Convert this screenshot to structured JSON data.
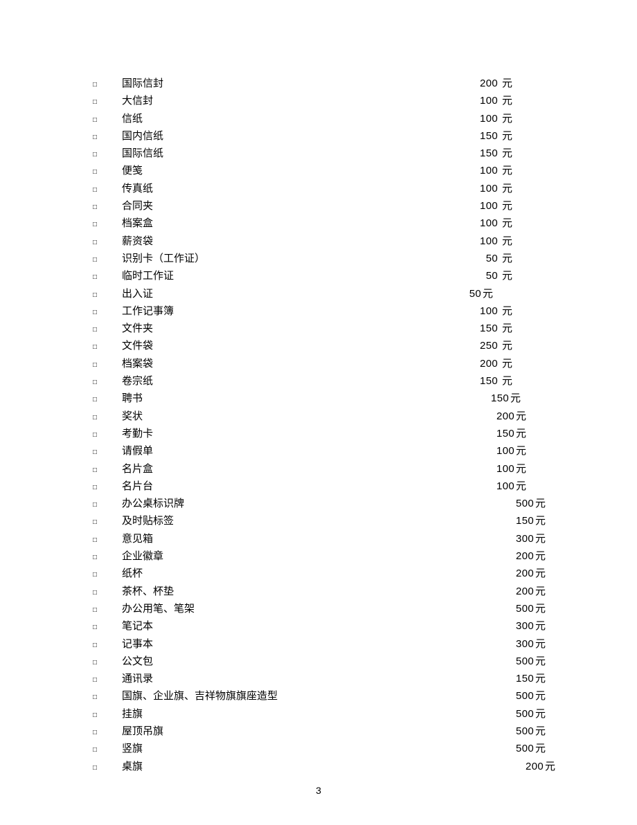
{
  "page_number": "3",
  "unit_label": "元",
  "bullet": "□",
  "items": [
    {
      "name": "国际信封",
      "price": "200",
      "indent": 0,
      "gap": 6
    },
    {
      "name": "大信封",
      "price": "100",
      "indent": 0,
      "gap": 6
    },
    {
      "name": "信纸",
      "price": "100",
      "indent": 0,
      "gap": 6
    },
    {
      "name": "国内信纸",
      "price": "150",
      "indent": 0,
      "gap": 6
    },
    {
      "name": "国际信纸",
      "price": "150",
      "indent": 0,
      "gap": 6
    },
    {
      "name": "便笺",
      "price": "100",
      "indent": 0,
      "gap": 6
    },
    {
      "name": "传真纸",
      "price": "100",
      "indent": 0,
      "gap": 6
    },
    {
      "name": "合同夹",
      "price": "100",
      "indent": 0,
      "gap": 6
    },
    {
      "name": "档案盒",
      "price": "100",
      "indent": 0,
      "gap": 6
    },
    {
      "name": "薪资袋",
      "price": "100",
      "indent": 0,
      "gap": 6
    },
    {
      "name": "识别卡（工作证）",
      "price": "50",
      "indent": 0,
      "gap": 6
    },
    {
      "name": "临时工作证",
      "price": "50",
      "indent": 0,
      "gap": 6
    },
    {
      "name": "出入证",
      "price": "50",
      "indent": -28,
      "gap": 2
    },
    {
      "name": "工作记事簿",
      "price": "100",
      "indent": 0,
      "gap": 6
    },
    {
      "name": "文件夹",
      "price": "150",
      "indent": 0,
      "gap": 6
    },
    {
      "name": "文件袋",
      "price": "250",
      "indent": 0,
      "gap": 6
    },
    {
      "name": "档案袋",
      "price": "200",
      "indent": 0,
      "gap": 6
    },
    {
      "name": "卷宗纸",
      "price": "150",
      "indent": 0,
      "gap": 6
    },
    {
      "name": "聘书",
      "price": "150",
      "indent": 12,
      "gap": 2
    },
    {
      "name": "奖状",
      "price": "200",
      "indent": 20,
      "gap": 2
    },
    {
      "name": "考勤卡",
      "price": "150",
      "indent": 20,
      "gap": 2
    },
    {
      "name": "请假单",
      "price": "100",
      "indent": 20,
      "gap": 2
    },
    {
      "name": "名片盒",
      "price": "100",
      "indent": 20,
      "gap": 2
    },
    {
      "name": "名片台",
      "price": "100",
      "indent": 20,
      "gap": 2
    },
    {
      "name": "办公桌标识牌",
      "price": "500",
      "indent": 48,
      "gap": 2
    },
    {
      "name": "及时贴标签",
      "price": "150",
      "indent": 48,
      "gap": 2
    },
    {
      "name": "意见箱",
      "price": "300",
      "indent": 48,
      "gap": 2
    },
    {
      "name": "企业徽章",
      "price": "200",
      "indent": 48,
      "gap": 2
    },
    {
      "name": "纸杯",
      "price": "200",
      "indent": 48,
      "gap": 2
    },
    {
      "name": "茶杯、杯垫",
      "price": "200",
      "indent": 48,
      "gap": 2
    },
    {
      "name": "办公用笔、笔架",
      "price": "500",
      "indent": 48,
      "gap": 2
    },
    {
      "name": "笔记本",
      "price": "300",
      "indent": 48,
      "gap": 2
    },
    {
      "name": "记事本",
      "price": "300",
      "indent": 48,
      "gap": 2
    },
    {
      "name": "公文包",
      "price": "500",
      "indent": 48,
      "gap": 2
    },
    {
      "name": "通讯录",
      "price": "150",
      "indent": 48,
      "gap": 2
    },
    {
      "name": "国旗、企业旗、吉祥物旗旗座造型",
      "price": "500",
      "indent": 48,
      "gap": 2
    },
    {
      "name": "挂旗",
      "price": "500",
      "indent": 48,
      "gap": 2
    },
    {
      "name": "屋顶吊旗",
      "price": "500",
      "indent": 48,
      "gap": 2
    },
    {
      "name": "竖旗",
      "price": "500",
      "indent": 48,
      "gap": 2
    },
    {
      "name": "桌旗",
      "price": "200",
      "indent": 62,
      "gap": 2
    }
  ]
}
